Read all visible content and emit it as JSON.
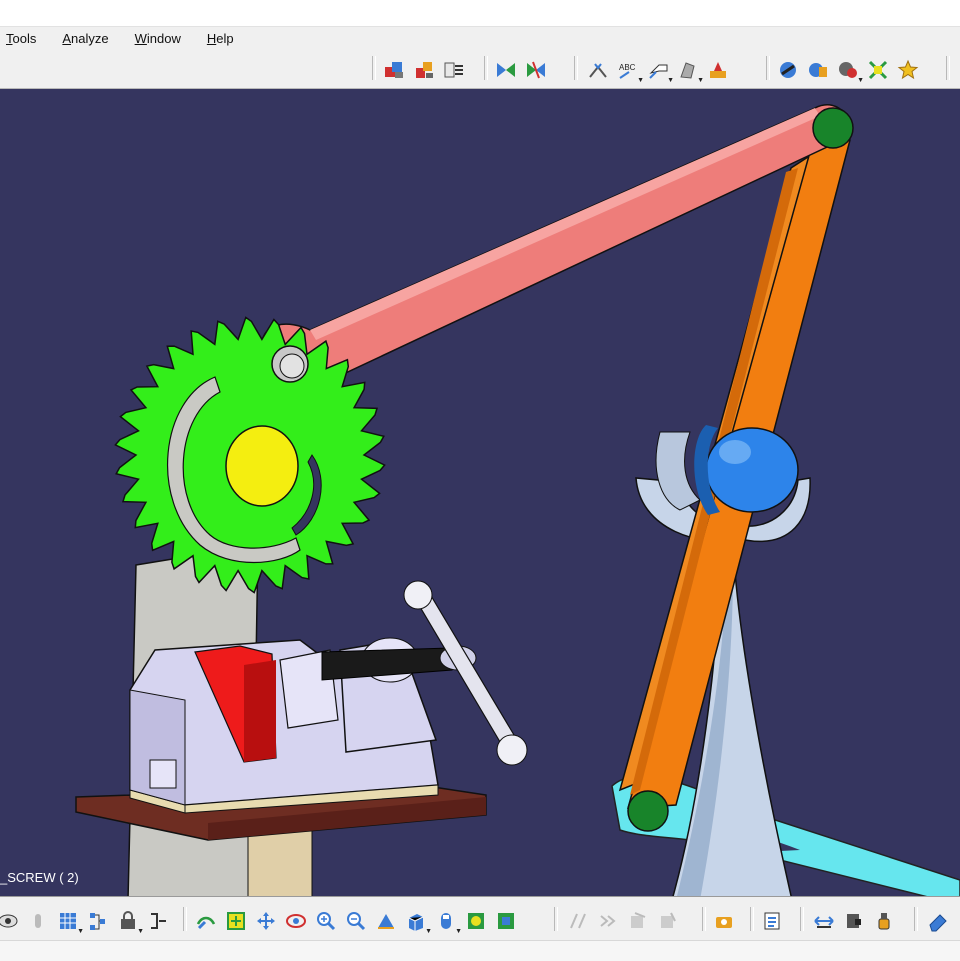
{
  "menu": {
    "items": [
      "Tools",
      "Analyze",
      "Window",
      "Help"
    ]
  },
  "viewport": {
    "background": "#35355f",
    "status_label": "_SCREW ( 2)"
  },
  "colors": {
    "gear": "#33ee1a",
    "hub": "#f4ee10",
    "link": "#ee7d7a",
    "arm": "#f27e10",
    "pivot": "#18842a",
    "ball": "#1f7fe8",
    "vise": "#d6d4f0",
    "jaw": "#ee1b1b",
    "table": "#6e2d22",
    "stand": "#c8d6ea",
    "cyan_link": "#66e6ee"
  },
  "toolbar_top_icons": [
    "insert-product-icon",
    "existing-component-icon",
    "replace-component-icon",
    "explode-icon",
    "snap-icon",
    "measure-between-icon",
    "text-annotation-icon",
    "flag-note-icon",
    "weld-icon",
    "catalog-icon",
    "simulation-icon",
    "kinematics-icon",
    "mechanism-dressup-icon",
    "clash-icon",
    "compile-simulation-icon"
  ],
  "toolbar_bottom_icons": [
    "fly-mode-icon",
    "lock-icon",
    "grid-icon",
    "tree-icon",
    "safe-icon",
    "spec-tree-icon",
    "fit-all-icon",
    "pan-icon",
    "rotate-icon",
    "zoom-in-icon",
    "zoom-out-icon",
    "normal-view-icon",
    "iso-view-icon",
    "shading-icon",
    "hide-show-icon",
    "swap-visible-icon",
    "parallel-icon",
    "perspective-icon",
    "camera-icon",
    "render-icon",
    "measure-icon",
    "publish-icon",
    "mass-icon",
    "eraser-icon"
  ]
}
